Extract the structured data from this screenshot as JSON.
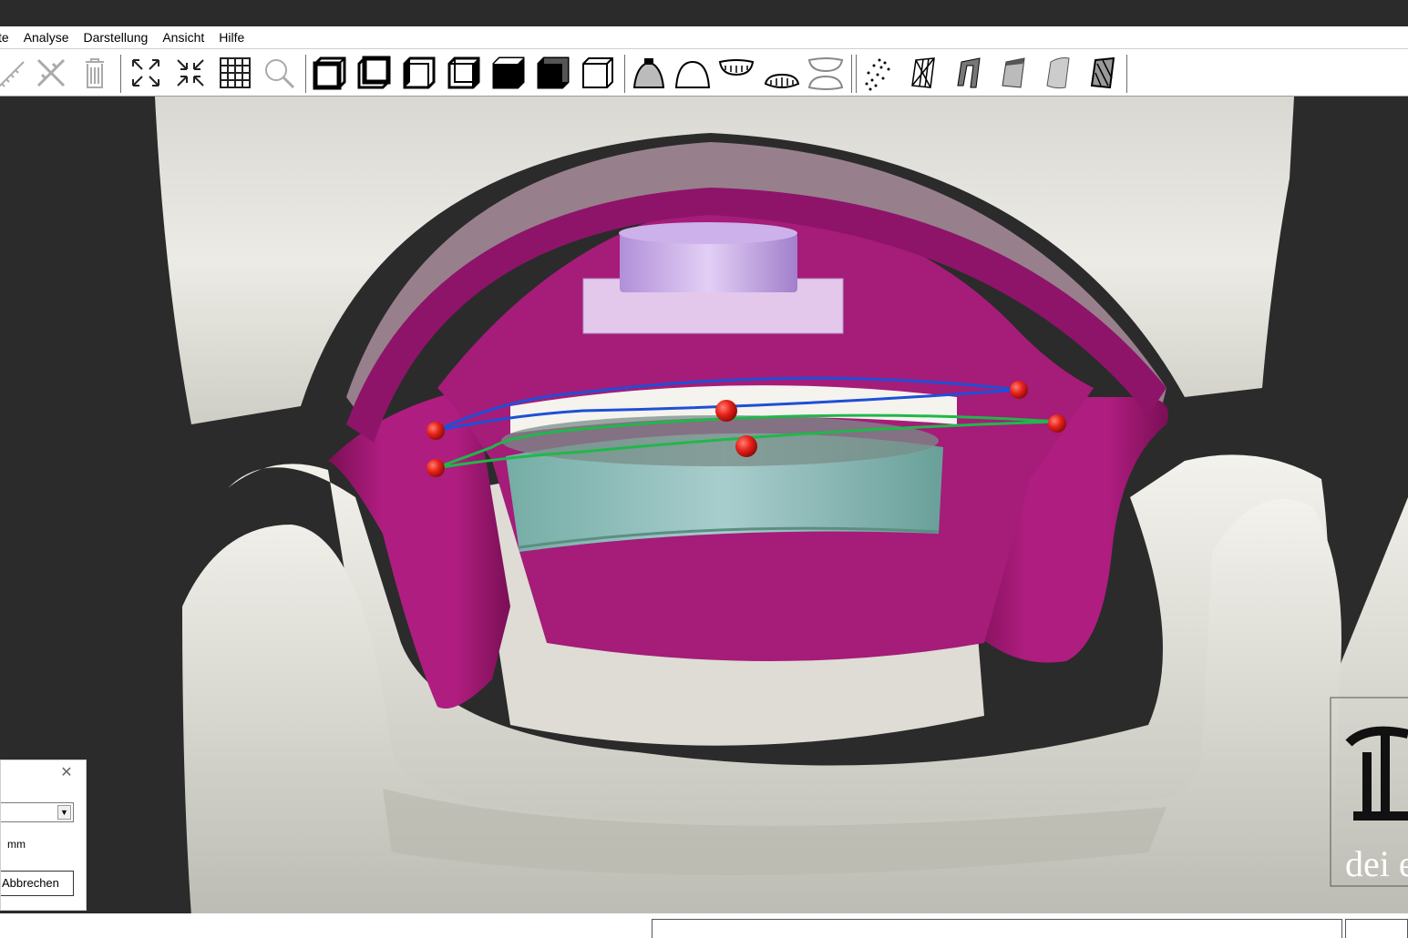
{
  "menu": {
    "items": [
      {
        "name": "menu-edit-partial",
        "label": "te"
      },
      {
        "name": "menu-analyse",
        "label": "Analyse"
      },
      {
        "name": "menu-darstellung",
        "label": "Darstellung"
      },
      {
        "name": "menu-ansicht",
        "label": "Ansicht"
      },
      {
        "name": "menu-hilfe",
        "label": "Hilfe"
      }
    ]
  },
  "toolbar": {
    "icons": [
      "ruler-icon",
      "ruler-cross-icon",
      "trash-icon",
      "zoom-extents-icon",
      "zoom-in-icon",
      "grid-icon",
      "magnifier-icon",
      "view-front-icon",
      "view-back-icon",
      "view-left-icon",
      "view-right-icon",
      "view-top-icon",
      "view-bottom-icon",
      "view-iso-icon",
      "impression-tray-icon",
      "dome-icon",
      "upper-jaw-icon",
      "lower-jaw-icon",
      "both-jaws-icon",
      "point-cloud-icon",
      "model-wireframe-icon",
      "model-solid-icon",
      "model-shaded-icon",
      "model-smooth-icon",
      "model-hatched-icon"
    ]
  },
  "dialog": {
    "unit": "mm",
    "cancel_label": "Abbrechen"
  },
  "colors": {
    "background": "#2b2b2b",
    "model": "#e6e4dc",
    "gingiva": "#a51c79",
    "magnet": "#c9a6e8",
    "cylinder": "#7fd9c4",
    "curve_blue": "#1f4fd6",
    "curve_green": "#1fb84a",
    "marker": "#e8221b"
  },
  "watermark": {
    "text": "dei e"
  }
}
